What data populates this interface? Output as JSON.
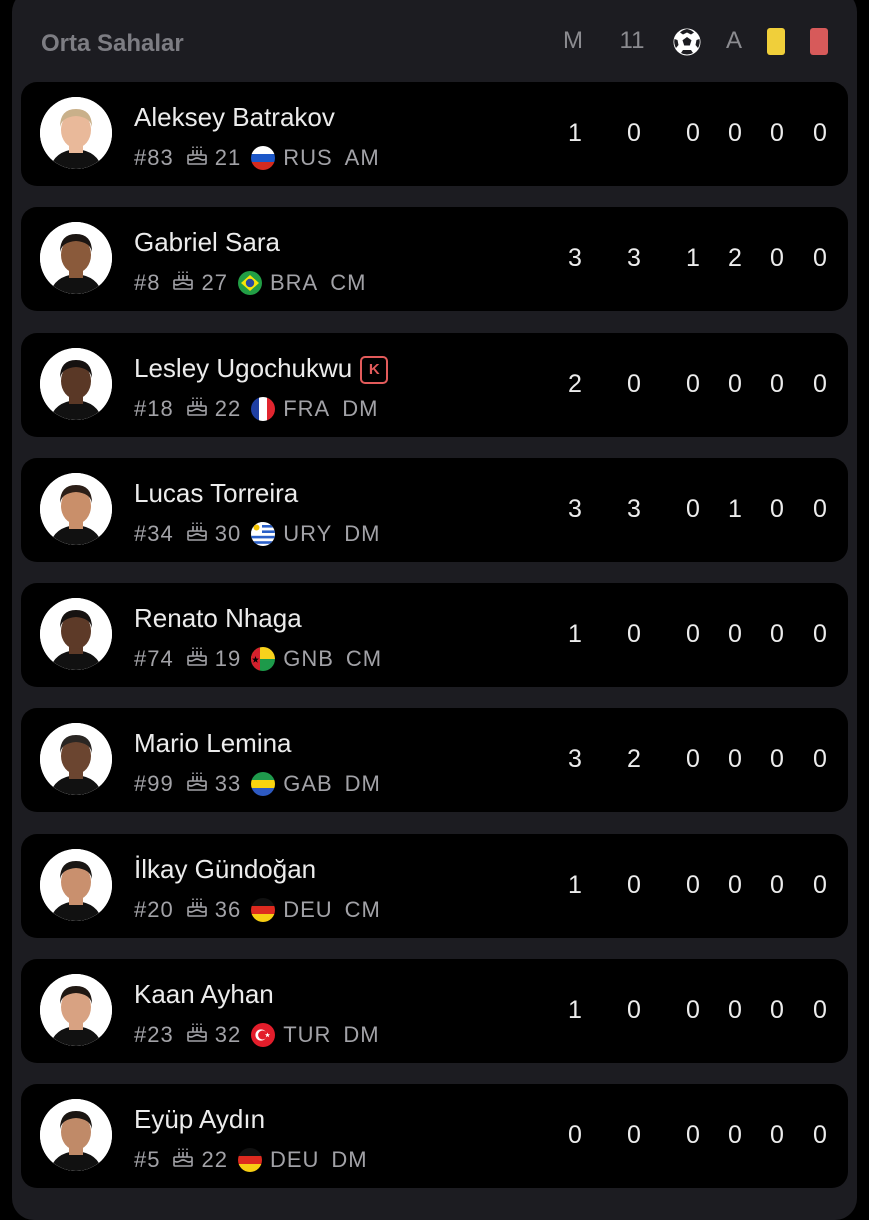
{
  "section": {
    "title": "Orta Sahalar"
  },
  "columns": {
    "matches": "M",
    "starts": "11",
    "goals_icon": "soccer-ball-icon",
    "assists": "A",
    "yellow_icon": "yellow-card-icon",
    "red_icon": "red-card-icon",
    "yellow_color": "#f0cf3a",
    "red_color": "#d75a5a"
  },
  "players": [
    {
      "name": "Aleksey Batrakov",
      "number": "#83",
      "age": "21",
      "country": "RUS",
      "position": "AM",
      "flag": "RUS",
      "captain": "",
      "stats": [
        "1",
        "0",
        "0",
        "0",
        "0",
        "0"
      ]
    },
    {
      "name": "Gabriel Sara",
      "number": "#8",
      "age": "27",
      "country": "BRA",
      "position": "CM",
      "flag": "BRA",
      "captain": "",
      "stats": [
        "3",
        "3",
        "1",
        "2",
        "0",
        "0"
      ]
    },
    {
      "name": "Lesley Ugochukwu",
      "number": "#18",
      "age": "22",
      "country": "FRA",
      "position": "DM",
      "flag": "FRA",
      "captain": "K",
      "stats": [
        "2",
        "0",
        "0",
        "0",
        "0",
        "0"
      ]
    },
    {
      "name": "Lucas Torreira",
      "number": "#34",
      "age": "30",
      "country": "URY",
      "position": "DM",
      "flag": "URY",
      "captain": "",
      "stats": [
        "3",
        "3",
        "0",
        "1",
        "0",
        "0"
      ]
    },
    {
      "name": "Renato Nhaga",
      "number": "#74",
      "age": "19",
      "country": "GNB",
      "position": "CM",
      "flag": "GNB",
      "captain": "",
      "stats": [
        "1",
        "0",
        "0",
        "0",
        "0",
        "0"
      ]
    },
    {
      "name": "Mario Lemina",
      "number": "#99",
      "age": "33",
      "country": "GAB",
      "position": "DM",
      "flag": "GAB",
      "captain": "",
      "stats": [
        "3",
        "2",
        "0",
        "0",
        "0",
        "0"
      ]
    },
    {
      "name": "İlkay Gündoğan",
      "number": "#20",
      "age": "36",
      "country": "DEU",
      "position": "CM",
      "flag": "DEU",
      "captain": "",
      "stats": [
        "1",
        "0",
        "0",
        "0",
        "0",
        "0"
      ]
    },
    {
      "name": "Kaan Ayhan",
      "number": "#23",
      "age": "32",
      "country": "TUR",
      "position": "DM",
      "flag": "TUR",
      "captain": "",
      "stats": [
        "1",
        "0",
        "0",
        "0",
        "0",
        "0"
      ]
    },
    {
      "name": "Eyüp Aydın",
      "number": "#5",
      "age": "22",
      "country": "DEU",
      "position": "DM",
      "flag": "DEU",
      "captain": "",
      "stats": [
        "0",
        "0",
        "0",
        "0",
        "0",
        "0"
      ]
    }
  ]
}
